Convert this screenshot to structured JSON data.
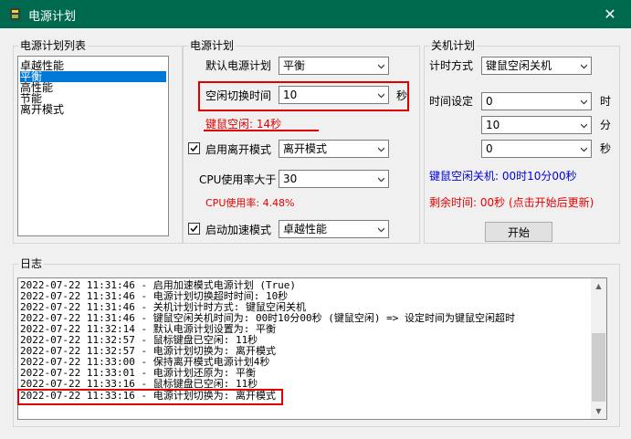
{
  "window": {
    "title": "电源计划",
    "close_symbol": "✕"
  },
  "plan_list": {
    "group_label": "电源计划列表",
    "items": [
      "卓越性能",
      "平衡",
      "高性能",
      "节能",
      "离开模式"
    ],
    "selected_index": 1
  },
  "power_plan": {
    "group_label": "电源计划",
    "default_plan_label": "默认电源计划",
    "default_plan_value": "平衡",
    "idle_switch_label": "空闲切换时间",
    "idle_switch_value": "10",
    "idle_switch_unit": "秒",
    "idle_status": "键鼠空闲: 14秒",
    "away_mode_label": "启用离开模式",
    "away_mode_checked": true,
    "away_mode_value": "离开模式",
    "cpu_label": "CPU使用率大于",
    "cpu_value": "30",
    "cpu_status": "CPU使用率: 4.48%",
    "boost_label": "启动加速模式",
    "boost_checked": true,
    "boost_value": "卓越性能"
  },
  "shutdown_plan": {
    "group_label": "关机计划",
    "timer_mode_label": "计时方式",
    "timer_mode_value": "键鼠空闲关机",
    "time_set_label": "时间设定",
    "hour_value": "0",
    "hour_unit": "时",
    "minute_value": "10",
    "minute_unit": "分",
    "second_value": "0",
    "second_unit": "秒",
    "shutdown_status": "键鼠空闲关机: 00时10分00秒",
    "remaining_status": "剩余时间: 00秒 (点击开始后更新)",
    "start_button": "开始"
  },
  "log": {
    "group_label": "日志",
    "lines": [
      "2022-07-22 11:31:46 - 启用加速模式电源计划 (True)",
      "2022-07-22 11:31:46 - 电源计划切换超时时间: 10秒",
      "2022-07-22 11:31:46 - 关机计划计时方式: 键鼠空闲关机",
      "2022-07-22 11:31:46 - 键鼠空闲关机时间为: 00时10分00秒 (键鼠空闲) => 设定时间为键鼠空闲超时",
      "2022-07-22 11:32:14 - 默认电源计划设置为: 平衡",
      "2022-07-22 11:32:57 - 鼠标键盘已空闲: 11秒",
      "2022-07-22 11:32:57 - 电源计划切换为: 离开模式",
      "2022-07-22 11:33:00 - 保持离开模式电源计划4秒",
      "2022-07-22 11:33:01 - 电源计划还原为: 平衡",
      "2022-07-22 11:33:16 - 鼠标键盘已空闲: 11秒",
      "2022-07-22 11:33:16 - 电源计划切换为: 离开模式"
    ]
  },
  "colors": {
    "titlebar": "#006a4e",
    "highlight_box": "#e00000",
    "status_red": "#e80000",
    "status_blue": "#0000e0",
    "selection": "#0078d7"
  }
}
